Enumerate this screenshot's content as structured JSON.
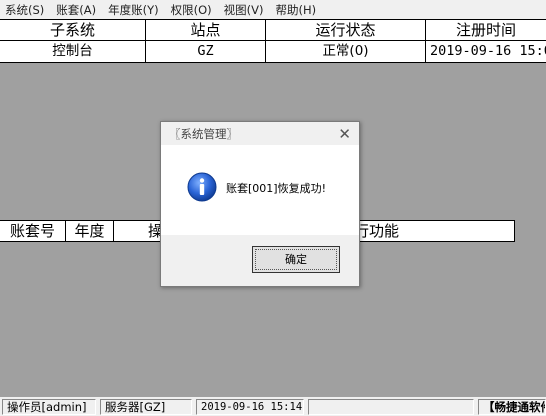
{
  "menu": [
    {
      "label": "系统(S)"
    },
    {
      "label": "账套(A)"
    },
    {
      "label": "年度账(Y)"
    },
    {
      "label": "权限(O)"
    },
    {
      "label": "视图(V)"
    },
    {
      "label": "帮助(H)"
    }
  ],
  "subsystem_table": {
    "headers": [
      "子系统",
      "站点",
      "运行状态",
      "注册时间"
    ],
    "rows": [
      {
        "subsystem": "控制台",
        "site": "GZ",
        "status": "正常(0)",
        "time": "2019-09-16 15:0"
      }
    ]
  },
  "task_table": {
    "headers": [
      "账套号",
      "年度",
      "操",
      "行功能"
    ]
  },
  "dialog": {
    "title": "〖系统管理〗",
    "icon": "info-icon",
    "message": "账套[001]恢复成功!",
    "ok_label": "确定"
  },
  "statusbar": {
    "operator": "操作员[admin]",
    "server": "服务器[GZ]",
    "datetime": "2019-09-16 15:14",
    "extra": "",
    "brand": "【畅捷通软件"
  },
  "colors": {
    "workspace": "#a0a0a0",
    "info_icon_blue": "#1f5fc8"
  }
}
